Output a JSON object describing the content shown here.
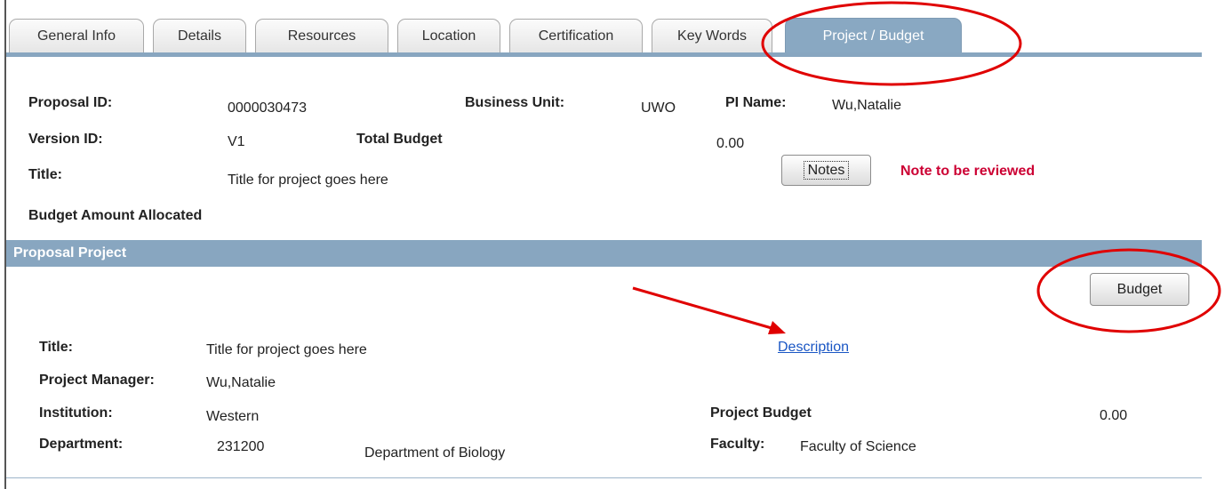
{
  "tabs": [
    {
      "label": "General Info"
    },
    {
      "label": "Details"
    },
    {
      "label": "Resources"
    },
    {
      "label": "Location"
    },
    {
      "label": "Certification"
    },
    {
      "label": "Key Words"
    },
    {
      "label": "Project / Budget"
    }
  ],
  "active_tab": "Project / Budget",
  "header": {
    "proposal_id_label": "Proposal ID:",
    "proposal_id": "0000030473",
    "business_unit_label": "Business Unit:",
    "business_unit": "UWO",
    "pi_name_label": "PI Name:",
    "pi_name": "Wu,Natalie",
    "version_id_label": "Version ID:",
    "version_id": "V1",
    "total_budget_label": "Total Budget",
    "total_budget": "0.00",
    "title_label": "Title:",
    "title": "Title for project goes here",
    "notes_button": "Notes",
    "note_status": "Note to be reviewed",
    "budget_allocated_label": "Budget Amount Allocated"
  },
  "project": {
    "section_title": "Proposal Project",
    "budget_button": "Budget",
    "title_label": "Title:",
    "title": "Title for project goes here",
    "description_link": "Description",
    "manager_label": "Project Manager:",
    "manager": "Wu,Natalie",
    "institution_label": "Institution:",
    "institution": "Western",
    "project_budget_label": "Project Budget",
    "project_budget": "0.00",
    "department_label": "Department:",
    "department_code": "231200",
    "department_name": "Department of Biology",
    "faculty_label": "Faculty:",
    "faculty": "Faculty of Science"
  },
  "colors": {
    "tab_active": "#89a8c2",
    "section_bar": "#88a6c0",
    "note_red": "#cc0033",
    "link_blue": "#1a56c4",
    "annotation_red": "#e00000"
  }
}
